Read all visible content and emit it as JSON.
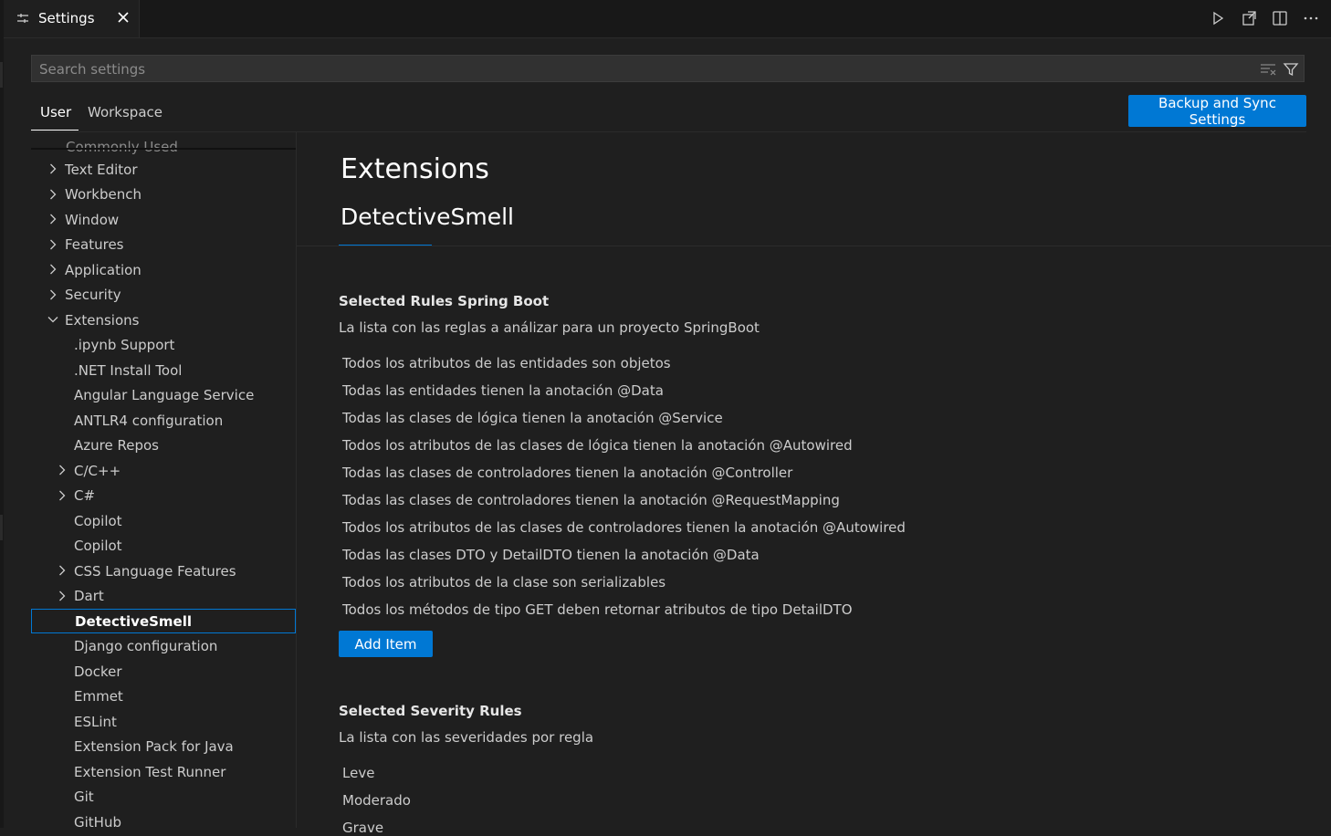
{
  "tab": {
    "label": "Settings",
    "icon": "settings-sliders-icon"
  },
  "title_actions": [
    "run-icon",
    "open-settings-json-icon",
    "split-editor-icon",
    "more-actions-icon"
  ],
  "search": {
    "placeholder": "Search settings",
    "value": ""
  },
  "scope_tabs": {
    "user": "User",
    "workspace": "Workspace",
    "active": "User"
  },
  "sync_button": "Backup and Sync Settings",
  "toc": {
    "partial_top": "Commonly Used",
    "items": [
      {
        "label": "Text Editor",
        "expandable": true,
        "expanded": false
      },
      {
        "label": "Workbench",
        "expandable": true,
        "expanded": false
      },
      {
        "label": "Window",
        "expandable": true,
        "expanded": false
      },
      {
        "label": "Features",
        "expandable": true,
        "expanded": false
      },
      {
        "label": "Application",
        "expandable": true,
        "expanded": false
      },
      {
        "label": "Security",
        "expandable": true,
        "expanded": false
      },
      {
        "label": "Extensions",
        "expandable": true,
        "expanded": true
      },
      {
        "label": ".ipynb Support",
        "expandable": false
      },
      {
        "label": ".NET Install Tool",
        "expandable": false
      },
      {
        "label": "Angular Language Service",
        "expandable": false
      },
      {
        "label": "ANTLR4 configuration",
        "expandable": false
      },
      {
        "label": "Azure Repos",
        "expandable": false
      },
      {
        "label": "C/C++",
        "expandable": true,
        "expanded": false
      },
      {
        "label": "C#",
        "expandable": true,
        "expanded": false
      },
      {
        "label": "Copilot",
        "expandable": false
      },
      {
        "label": "Copilot",
        "expandable": false
      },
      {
        "label": "CSS Language Features",
        "expandable": true,
        "expanded": false
      },
      {
        "label": "Dart",
        "expandable": true,
        "expanded": false
      },
      {
        "label": "DetectiveSmell",
        "expandable": false,
        "selected": true
      },
      {
        "label": "Django configuration",
        "expandable": false
      },
      {
        "label": "Docker",
        "expandable": false
      },
      {
        "label": "Emmet",
        "expandable": false
      },
      {
        "label": "ESLint",
        "expandable": false
      },
      {
        "label": "Extension Pack for Java",
        "expandable": false
      },
      {
        "label": "Extension Test Runner",
        "expandable": false
      },
      {
        "label": "Git",
        "expandable": false
      },
      {
        "label": "GitHub",
        "expandable": false
      }
    ]
  },
  "main": {
    "section_title": "Extensions",
    "subsection_title": "DetectiveSmell",
    "settings": [
      {
        "title": "Selected Rules Spring Boot",
        "description": "La lista con las reglas a análizar para un proyecto SpringBoot",
        "items": [
          "Todos los atributos de las entidades son objetos",
          "Todas las entidades tienen la anotación @Data",
          "Todas las clases de lógica tienen la anotación @Service",
          "Todos los atributos de las clases de lógica tienen la anotación @Autowired",
          "Todas las clases de controladores tienen la anotación @Controller",
          "Todas las clases de controladores tienen la anotación @RequestMapping",
          "Todos los atributos de las clases de controladores tienen la anotación @Autowired",
          "Todas las clases DTO y DetailDTO tienen la anotación @Data",
          "Todos los atributos de la clase son serializables",
          "Todos los métodos de tipo GET deben retornar atributos de tipo DetailDTO"
        ],
        "add_button": "Add Item"
      },
      {
        "title": "Selected Severity Rules",
        "description": "La lista con las severidades por regla",
        "items": [
          "Leve",
          "Moderado",
          "Grave"
        ]
      }
    ]
  },
  "colors": {
    "accent": "#0078d4",
    "background": "#1f1f1f",
    "text": "#cccccc"
  }
}
